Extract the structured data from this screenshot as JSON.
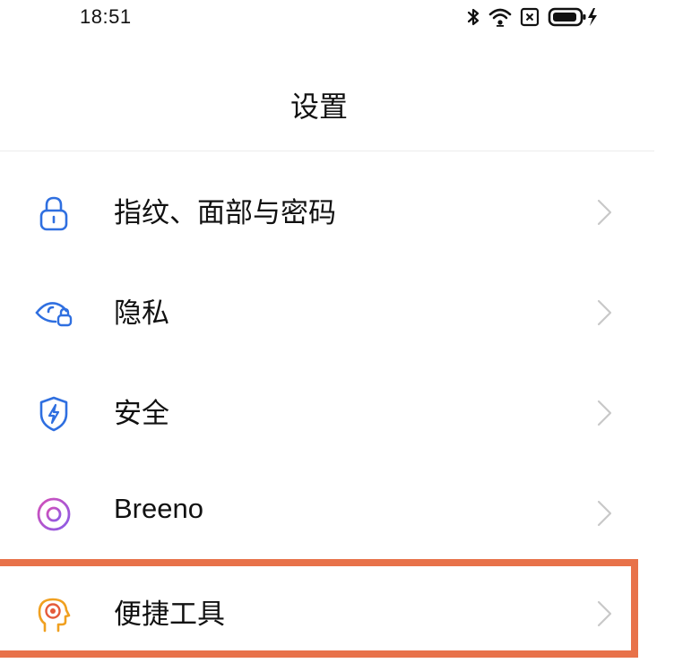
{
  "status_bar": {
    "time": "18:51",
    "icons": [
      "bluetooth-icon",
      "wifi-icon",
      "no-sim-icon",
      "battery-charging-icon"
    ]
  },
  "header": {
    "title": "设置"
  },
  "settings": {
    "items": [
      {
        "label": "指纹、面部与密码",
        "icon": "lock-icon",
        "icon_color": "#2f6fe0"
      },
      {
        "label": "隐私",
        "icon": "privacy-eye-lock-icon",
        "icon_color": "#2f6fe0"
      },
      {
        "label": "安全",
        "icon": "shield-bolt-icon",
        "icon_color": "#2f6fe0"
      },
      {
        "label": "Breeno",
        "icon": "breeno-ring-icon",
        "icon_color": "#b056d6"
      },
      {
        "label": "便捷工具",
        "icon": "head-target-icon",
        "icon_color": "#f0a020"
      }
    ]
  },
  "colors": {
    "highlight": "#e8724a",
    "chevron": "#c8c8c8",
    "divider": "#ececec"
  }
}
